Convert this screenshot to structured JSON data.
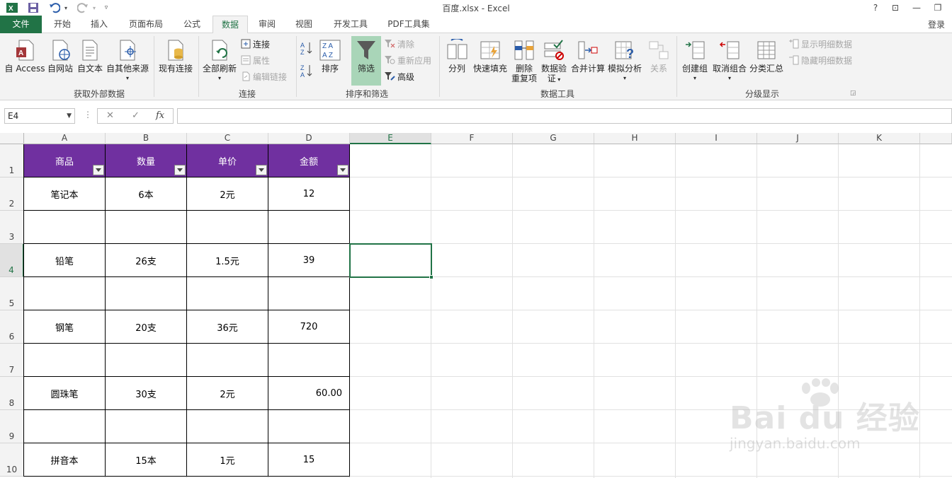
{
  "titlebar": {
    "title": "百度.xlsx - Excel",
    "help": "?",
    "ribbon_display": "⊡",
    "minimize": "—",
    "restore": "❐"
  },
  "tabs": [
    "文件",
    "开始",
    "插入",
    "页面布局",
    "公式",
    "数据",
    "审阅",
    "视图",
    "开发工具",
    "PDF工具集"
  ],
  "active_tab": "数据",
  "login": "登录",
  "ribbon": {
    "get_external": {
      "label": "获取外部数据",
      "access": "自 Access",
      "web": "自网站",
      "text": "自文本",
      "other": "自其他来源"
    },
    "existing_connections": "现有连接",
    "connections": {
      "label": "连接",
      "refresh_all": "全部刷新",
      "connections": "连接",
      "properties": "属性",
      "edit_links": "编辑链接"
    },
    "sort_filter": {
      "label": "排序和筛选",
      "sort": "排序",
      "filter": "筛选",
      "clear": "清除",
      "reapply": "重新应用",
      "advanced": "高级"
    },
    "data_tools": {
      "label": "数据工具",
      "text_to_columns": "分列",
      "flash_fill": "快速填充",
      "remove_dup_1": "删除",
      "remove_dup_2": "重复项",
      "validation_1": "数据验",
      "validation_2": "证",
      "consolidate": "合并计算",
      "what_if": "模拟分析",
      "relationships": "关系"
    },
    "outline": {
      "label": "分级显示",
      "group": "创建组",
      "ungroup": "取消组合",
      "subtotal": "分类汇总",
      "show_detail": "显示明细数据",
      "hide_detail": "隐藏明细数据"
    }
  },
  "formula_bar": {
    "name_box": "E4",
    "cancel": "✕",
    "enter": "✓",
    "fx": "fx",
    "value": ""
  },
  "columns": [
    "A",
    "B",
    "C",
    "D",
    "E",
    "F",
    "G",
    "H",
    "I",
    "J",
    "K"
  ],
  "rows": [
    "1",
    "2",
    "3",
    "4",
    "5",
    "6",
    "7",
    "8",
    "9",
    "10"
  ],
  "table": {
    "headers": [
      "商品",
      "数量",
      "单价",
      "金额"
    ],
    "rows": [
      [
        "笔记本",
        "6本",
        "2元",
        "12"
      ],
      [
        "",
        "",
        "",
        ""
      ],
      [
        "铅笔",
        "26支",
        "1.5元",
        "39"
      ],
      [
        "",
        "",
        "",
        ""
      ],
      [
        "钢笔",
        "20支",
        "36元",
        "720"
      ],
      [
        "",
        "",
        "",
        ""
      ],
      [
        "圆珠笔",
        "30支",
        "2元",
        "60.00"
      ],
      [
        "",
        "",
        "",
        ""
      ],
      [
        "拼音本",
        "15本",
        "1元",
        "15"
      ]
    ]
  },
  "selected_cell": "E4",
  "colors": {
    "header_fill": "#7030a0",
    "excel_green": "#217346",
    "filter_active": "#a9d5b8"
  },
  "watermark": {
    "brand": "Bai du 经验",
    "url": "jingyan.baidu.com"
  }
}
